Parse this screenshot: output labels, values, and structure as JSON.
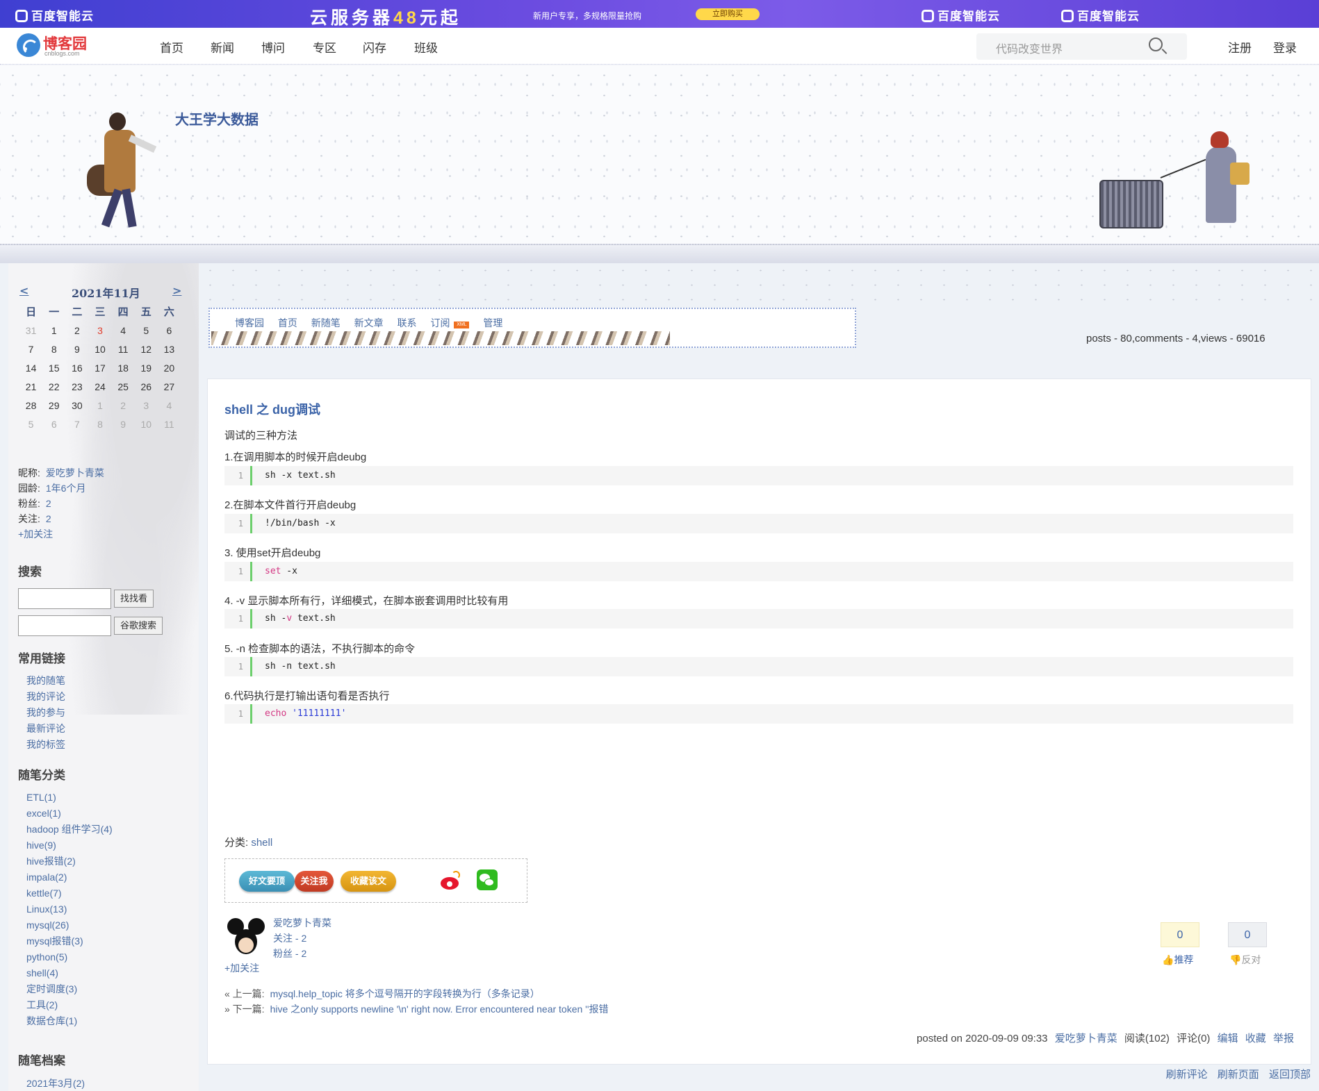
{
  "ad": {
    "brand": "百度智能云",
    "headline_pre": "云服务器",
    "headline_num": "48",
    "headline_post": "元起",
    "sub": "新用户专享，多规格限量抢购",
    "buy": "立即购买"
  },
  "site": {
    "name": "博客园",
    "domain": "cnblogs.com",
    "nav": [
      "首页",
      "新闻",
      "博问",
      "专区",
      "闪存",
      "班级"
    ],
    "search_placeholder": "代码改变世界",
    "register": "注册",
    "login": "登录"
  },
  "blog": {
    "title": "大王学大数据"
  },
  "calendar": {
    "prev": "<",
    "next": ">",
    "month": "2021年11月",
    "weekdays": [
      "日",
      "一",
      "二",
      "三",
      "四",
      "五",
      "六"
    ],
    "weeks": [
      [
        "31",
        "1",
        "2",
        "3",
        "4",
        "5",
        "6"
      ],
      [
        "7",
        "8",
        "9",
        "10",
        "11",
        "12",
        "13"
      ],
      [
        "14",
        "15",
        "16",
        "17",
        "18",
        "19",
        "20"
      ],
      [
        "21",
        "22",
        "23",
        "24",
        "25",
        "26",
        "27"
      ],
      [
        "28",
        "29",
        "30",
        "1",
        "2",
        "3",
        "4"
      ],
      [
        "5",
        "6",
        "7",
        "8",
        "9",
        "10",
        "11"
      ]
    ],
    "today": "3"
  },
  "profile": {
    "nickname_label": "昵称:",
    "nickname": "爱吃萝卜青菜",
    "age_label": "园龄:",
    "age": "1年6个月",
    "fans_label": "粉丝:",
    "fans": "2",
    "follow_label": "关注:",
    "follow": "2",
    "add_follow": "+加关注"
  },
  "search": {
    "heading": "搜索",
    "btn_site": "找找看",
    "btn_google": "谷歌搜索"
  },
  "links": {
    "heading": "常用链接",
    "items": [
      "我的随笔",
      "我的评论",
      "我的参与",
      "最新评论",
      "我的标签"
    ]
  },
  "categories": {
    "heading": "随笔分类",
    "items": [
      "ETL(1)",
      "excel(1)",
      "hadoop 组件学习(4)",
      "hive(9)",
      "hive报错(2)",
      "impala(2)",
      "kettle(7)",
      "Linux(13)",
      "mysql(26)",
      "mysql报错(3)",
      "python(5)",
      "shell(4)",
      "定时调度(3)",
      "工具(2)",
      "数据仓库(1)"
    ]
  },
  "archive": {
    "heading": "随笔档案",
    "items": [
      "2021年3月(2)"
    ]
  },
  "blognav": {
    "items": [
      "博客园",
      "首页",
      "新随笔",
      "新文章",
      "联系",
      "订阅"
    ],
    "xml": "XML",
    "manage": "管理"
  },
  "stats": "posts - 80,comments - 4,views - 69016",
  "post": {
    "title": "shell 之 dug调试",
    "intro": "调试的三种方法",
    "sections": [
      {
        "heading": " 1.在调用脚本的时候开启deubg",
        "code": [
          {
            "t": "sh -x text.sh"
          }
        ]
      },
      {
        "heading": "2.在脚本文件首行开启deubg",
        "code": [
          {
            "t": "!/bin/bash -x"
          }
        ]
      },
      {
        "heading": "3. 使用set开启deubg",
        "code": [
          {
            "t": "set",
            "c": "kw"
          },
          {
            "t": " -x"
          }
        ]
      },
      {
        "heading": "4. -v 显示脚本所有行，详细模式，在脚本嵌套调用时比较有用",
        "code": [
          {
            "t": "sh -"
          },
          {
            "t": "v",
            "c": "kw"
          },
          {
            "t": " text.sh"
          }
        ]
      },
      {
        "heading": "5. -n 检查脚本的语法，不执行脚本的命令",
        "code": [
          {
            "t": "sh -n text.sh"
          }
        ]
      },
      {
        "heading": "6.代码执行是打输出语句看是否执行",
        "code": [
          {
            "t": "echo",
            "c": "kw"
          },
          {
            "t": " "
          },
          {
            "t": "'11111111'",
            "c": "str"
          }
        ]
      }
    ],
    "line_no": "1",
    "category_label": "分类:",
    "category": "shell",
    "share": {
      "good": "好文要顶",
      "follow": "关注我",
      "fav": "收藏该文"
    },
    "author": {
      "name": "爱吃萝卜青菜",
      "follow": "关注 - 2",
      "fans": "粉丝 - 2",
      "add_follow": "+加关注"
    },
    "digg_count": "0",
    "bury_count": "0",
    "digg_label": "推荐",
    "bury_label": "反对",
    "prev_label": "« 上一篇:",
    "prev_title": "mysql.help_topic 将多个逗号隔开的字段转换为行（多条记录）",
    "next_label": "» 下一篇:",
    "next_title": "hive 之only supports newline '\\n' right now. Error encountered near token ''报错",
    "desc": {
      "posted": "posted on 2020-09-09 09:33",
      "author": "爱吃萝卜青菜",
      "read": "阅读(102)",
      "comments": "评论(0)",
      "edit": "编辑",
      "fav": "收藏",
      "report": "举报"
    }
  },
  "footer": [
    "刷新评论",
    "刷新页面",
    "返回顶部"
  ],
  "colors": {
    "accent": "#3b63a8",
    "ad_bg": "#5a3fd6",
    "code_bar": "#6ccf6c"
  }
}
